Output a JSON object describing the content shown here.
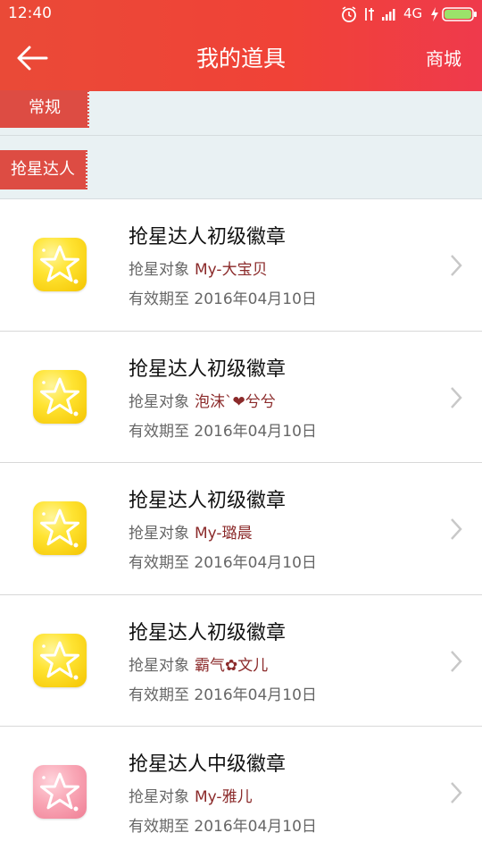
{
  "status_bar": {
    "time": "12:40",
    "network": "4G",
    "icons": [
      "alarm-icon",
      "vibrate-icon",
      "signal-icon",
      "charging-icon",
      "battery-icon"
    ]
  },
  "header": {
    "back_icon": "arrow-left-icon",
    "title": "我的道具",
    "store_label": "商城"
  },
  "sections": [
    {
      "label": "常规"
    },
    {
      "label": "抢星达人"
    }
  ],
  "items": [
    {
      "title": "抢星达人初级徽章",
      "target_label": "抢星对象",
      "target_name": "My-大宝贝",
      "expiry": "有效期至 2016年04月10日",
      "badge": "gold-star-badge"
    },
    {
      "title": "抢星达人初级徽章",
      "target_label": "抢星对象",
      "target_name": "泡沫`❤兮兮",
      "expiry": "有效期至 2016年04月10日",
      "badge": "gold-star-badge"
    },
    {
      "title": "抢星达人初级徽章",
      "target_label": "抢星对象",
      "target_name": "My-璐晨",
      "expiry": "有效期至 2016年04月10日",
      "badge": "gold-star-badge"
    },
    {
      "title": "抢星达人初级徽章",
      "target_label": "抢星对象",
      "target_name": "霸气✿文儿",
      "expiry": "有效期至 2016年04月10日",
      "badge": "gold-star-badge"
    },
    {
      "title": "抢星达人中级徽章",
      "target_label": "抢星对象",
      "target_name": "My-雅儿",
      "expiry": "有效期至 2016年04月10日",
      "badge": "pink-star-badge"
    }
  ],
  "colors": {
    "header_red": "#f04237",
    "section_tag": "#dd4c43",
    "section_bg": "#e9f1f3",
    "target_name": "#8b2a2a"
  }
}
